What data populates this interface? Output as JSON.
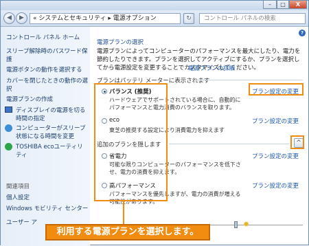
{
  "window": {
    "minimize_glyph": "–",
    "maximize_glyph": "□",
    "close_glyph": "X"
  },
  "addressbar": {
    "back_glyph": "◀",
    "forward_glyph": "▶",
    "path": "« システムとセキュリティ ▸ 電源オプション",
    "search_placeholder": "コントロール パネルの検索"
  },
  "sidebar": {
    "home": "コントロール パネル ホーム",
    "items": [
      "スリープ解除時のパスワード保護",
      "電源ボタンの動作を選択する",
      "カバーを閉じたときの動作の選択",
      "電源プランの作成",
      "ディスプレイの電源を切る時間の指定",
      "コンピューターがスリープ状態になる時間を変更",
      "TOSHIBA ecoユーティリティ"
    ],
    "related_heading": "関連項目",
    "related": [
      "個人設定",
      "Windows モビリティ センター",
      "ユーザー ア"
    ]
  },
  "main": {
    "title": "電源プランの選択",
    "intro": "電源プランによってコンピューターのパフォーマンスを最大にしたり、電力を節約したりできます。プランを選択してアクティブにするか、プランを選択してから電源設定を変更することでカスタマイズしてください。",
    "intro_link": "電源プランの詳細",
    "battery_section": "プランはバッテリ メーターに表示されます",
    "additional_section": "追加のプランを隠します",
    "change_link": "プラン設定の変更",
    "plans": [
      {
        "name": "バランス (推奨)",
        "desc": "ハードウェアでサポートされている場合に、自動的にパフォーマンスと電力消費のバランスを取ります。",
        "selected": true
      },
      {
        "name": "eco",
        "desc": "東芝の推奨する設定により消費電力を抑えます",
        "selected": false
      },
      {
        "name": "省電力",
        "desc": "可能な限りコンピューターのパフォーマンスを低下させ、電力の消費を抑えます。",
        "selected": false
      },
      {
        "name": "高パフォーマンス",
        "desc": "パフォーマンスを優先しますが、電力の消費が増える可能性があります。",
        "selected": false
      }
    ],
    "help_glyph": "?",
    "collapse_glyph": "^"
  },
  "callout": "利用する電源プランを選択します。",
  "colors": {
    "accent": "#f28c10",
    "link": "#1a57b0",
    "sidebar": "#e6eef8"
  }
}
